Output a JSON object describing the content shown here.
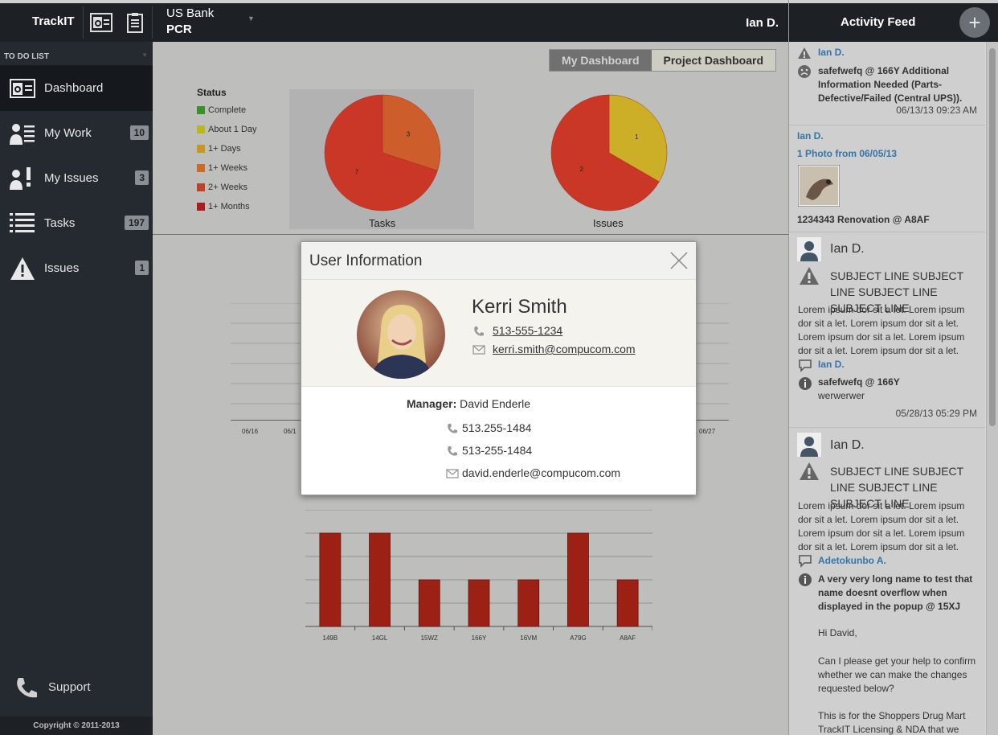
{
  "app": {
    "brand": "TrackIT",
    "client": "US Bank",
    "project": "PCR",
    "user": "Ian D."
  },
  "sidebar": {
    "section_title": "TO DO LIST",
    "items": [
      {
        "label": "Dashboard",
        "icon": "dashboard-icon",
        "badge": ""
      },
      {
        "label": "My Work",
        "icon": "my-work-icon",
        "badge": "10"
      },
      {
        "label": "My Issues",
        "icon": "my-issues-icon",
        "badge": "3"
      },
      {
        "label": "Tasks",
        "icon": "tasks-icon",
        "badge": "197"
      },
      {
        "label": "Issues",
        "icon": "warning-icon",
        "badge": "1"
      }
    ],
    "support_label": "Support",
    "copyright": "Copyright © 2011-2013"
  },
  "dashboard": {
    "tabs": [
      "My Dashboard",
      "Project Dashboard"
    ],
    "active_tab": "My Dashboard",
    "legend_title": "Status",
    "legend": [
      {
        "label": "Complete",
        "color": "#3d9a2b"
      },
      {
        "label": "About 1 Day",
        "color": "#c6c020"
      },
      {
        "label": "1+ Days",
        "color": "#d4a020"
      },
      {
        "label": "1+ Weeks",
        "color": "#d9702a"
      },
      {
        "label": "2+ Weeks",
        "color": "#c8462a"
      },
      {
        "label": "1+ Months",
        "color": "#b3201f"
      }
    ],
    "line_x_ticks": [
      "06/16",
      "06/1",
      "06/27"
    ],
    "bar_categories": [
      "149B",
      "14GL",
      "15WZ",
      "166Y",
      "16VM",
      "A79G",
      "A8AF"
    ]
  },
  "chart_data": [
    {
      "type": "pie",
      "title": "Tasks",
      "labels": [
        "1+ Months",
        "1+ Weeks"
      ],
      "values": [
        7,
        3
      ],
      "colors": [
        "#d63a2a",
        "#d9642e"
      ]
    },
    {
      "type": "pie",
      "title": "Issues",
      "labels": [
        "1+ Months",
        "About 1 Day"
      ],
      "values": [
        2,
        1
      ],
      "colors": [
        "#d63a2a",
        "#d9b92a"
      ]
    },
    {
      "type": "bar",
      "categories": [
        "149B",
        "14GL",
        "15WZ",
        "166Y",
        "16VM",
        "A79G",
        "A8AF"
      ],
      "values": [
        4,
        4,
        2,
        2,
        2,
        4,
        2
      ],
      "ylim": [
        0,
        5
      ],
      "color": "#a52316"
    }
  ],
  "modal": {
    "title": "User Information",
    "name": "Kerri Smith",
    "phone": "513-555-1234",
    "email": "kerri.smith@compucom.com",
    "manager_label": "Manager:",
    "manager_name": "David Enderle",
    "manager_phone_1": "513.255-1484",
    "manager_phone_2": "513-255-1484",
    "manager_email": "david.enderle@compucom.com"
  },
  "feed": {
    "title": "Activity Feed",
    "items": [
      {
        "user": "Ian D.",
        "text": "safefwefq @ 166Y Additional Information Needed (Parts-Defective/Failed (Central UPS)).",
        "time": "06/13/13 09:23 AM"
      },
      {
        "user": "Ian D.",
        "photo": "1 Photo from 06/05/13",
        "project": "1234343 Renovation @ A8AF"
      },
      {
        "user": "Ian D.",
        "subject": "SUBJECT LINE SUBJECT LINE SUBJECT LINE SUBJECT LINE",
        "body": "Lorem ipsum dor sit a let. Lorem ipsum dor sit a let. Lorem ipsum dor sit a let. Lorem ipsum dor sit a let. Lorem ipsum dor sit a let. Lorem ipsum dor sit a let.",
        "comment_user": "Ian D.",
        "ref": "safefwefq @ 166Y",
        "ref_text": "werwerwer",
        "time": "05/28/13 05:29 PM"
      },
      {
        "user": "Ian D.",
        "subject": "SUBJECT LINE SUBJECT LINE SUBJECT LINE SUBJECT LINE",
        "body": "Lorem ipsum dor sit a let. Lorem ipsum dor sit a let. Lorem ipsum dor sit a let. Lorem ipsum dor sit a let. Lorem ipsum dor sit a let. Lorem ipsum dor sit a let.",
        "comment_user": "Adetokunbo A.",
        "ref": "A very very long name to test that name doesnt overflow when displayed in the popup @ 15XJ",
        "msg_1": "Hi David,",
        "msg_2": "Can I please get your help to confirm whether we can make the changes requested below?",
        "msg_3": "This is for the Shoppers Drug Mart TrackIT Licensing & NDA that we"
      }
    ]
  }
}
